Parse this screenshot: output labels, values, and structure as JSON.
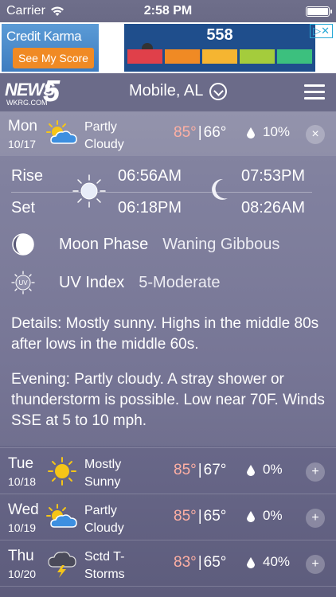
{
  "status_bar": {
    "carrier": "Carrier",
    "time": "2:58 PM",
    "battery_level": 1.0
  },
  "ad": {
    "brand": "Credit Karma",
    "cta": "See My Score",
    "score": "558",
    "bar_colors": [
      "#e0404a",
      "#f08a24",
      "#f5b531",
      "#a4cc3c",
      "#3cc07e"
    ]
  },
  "header": {
    "logo_text": "NEWS",
    "logo_number": "5",
    "logo_url": "WKRG.COM",
    "location": "Mobile, AL"
  },
  "today": {
    "day": "Mon",
    "date": "10/17",
    "condition_line1": "Partly",
    "condition_line2": "Cloudy",
    "high": "85°",
    "low": "66°",
    "precip": "10%",
    "button": "×"
  },
  "details": {
    "rise_label": "Rise",
    "set_label": "Set",
    "sunrise": "06:56AM",
    "sunset": "06:18PM",
    "moonrise": "07:53PM",
    "moonset": "08:26AM",
    "moon_phase_label": "Moon Phase",
    "moon_phase_value": "Waning Gibbous",
    "uv_label": "UV Index",
    "uv_value": "5-Moderate",
    "uv_icon_text": "UV",
    "summary": "Details: Mostly sunny. Highs in the middle 80s after lows in the middle 60s.",
    "evening": "Evening: Partly cloudy. A stray shower or thunderstorm is possible. Low near 70F. Winds SSE at 5 to 10 mph."
  },
  "forecast": [
    {
      "day": "Tue",
      "date": "10/18",
      "condition_line1": "Mostly",
      "condition_line2": "Sunny",
      "icon": "sun-icon",
      "high": "85°",
      "low": "67°",
      "precip": "0%",
      "button": "+"
    },
    {
      "day": "Wed",
      "date": "10/19",
      "condition_line1": "Partly",
      "condition_line2": "Cloudy",
      "icon": "partly-cloudy-icon",
      "high": "85°",
      "low": "65°",
      "precip": "0%",
      "button": "+"
    },
    {
      "day": "Thu",
      "date": "10/20",
      "condition_line1": "Sctd T-",
      "condition_line2": "Storms",
      "icon": "thunderstorm-icon",
      "high": "83°",
      "low": "65°",
      "precip": "40%",
      "button": "+"
    }
  ]
}
